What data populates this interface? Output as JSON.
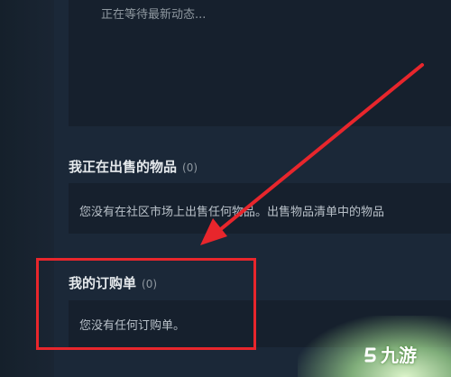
{
  "activity": {
    "status": "正在等待最新动态..."
  },
  "selling": {
    "title": "我正在出售的物品",
    "count": "(0)",
    "message": "您没有在社区市场上出售任何物品。出售物品清单中的物品"
  },
  "buy_orders": {
    "title": "我的订购单",
    "count": "(0)",
    "message": "您没有任何订购单。"
  },
  "watermark": {
    "text": "九游"
  },
  "colors": {
    "background": "#1b2838",
    "box": "#16202d",
    "highlight": "#e8262c"
  }
}
